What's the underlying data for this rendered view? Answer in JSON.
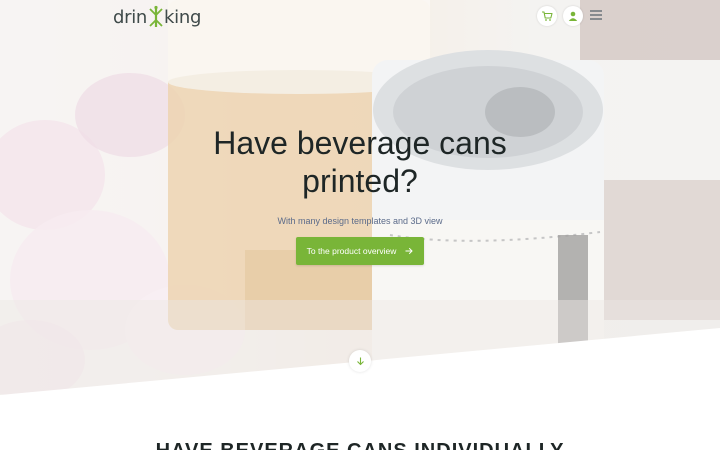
{
  "header": {
    "logo_text_start": "drin",
    "logo_text_end": "king",
    "icons": {
      "cart": "cart-icon",
      "user": "user-icon",
      "menu": "hamburger-menu-icon"
    }
  },
  "hero": {
    "title": "Have beverage cans printed?",
    "subtitle": "With many design templates and 3D view",
    "cta_label": "To the product overview",
    "background_description_icon": "beer-glass-and-can-photo"
  },
  "next_section": {
    "heading": "HAVE BEVERAGE CANS INDIVIDUALLY"
  },
  "colors": {
    "accent": "#79b538",
    "logo_text": "#3f4a4a",
    "title_text": "#1e2626",
    "subtitle_text": "#5b6b8a"
  }
}
